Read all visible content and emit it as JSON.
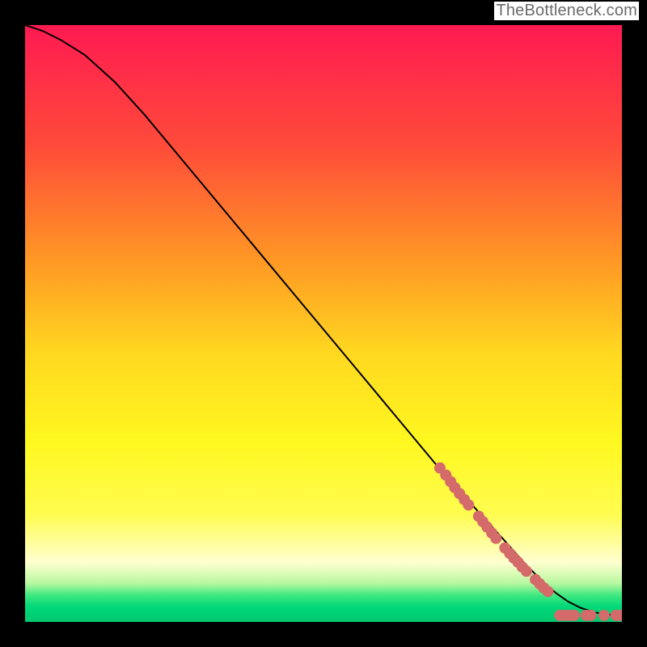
{
  "attribution": "TheBottleneck.com",
  "chart_data": {
    "type": "line",
    "title": "",
    "xlabel": "",
    "ylabel": "",
    "xlim": [
      0,
      100
    ],
    "ylim": [
      0,
      100
    ],
    "background_gradient": {
      "stops": [
        {
          "offset": 0.0,
          "color": "#ff1a52"
        },
        {
          "offset": 0.2,
          "color": "#ff4a3a"
        },
        {
          "offset": 0.4,
          "color": "#ff9a24"
        },
        {
          "offset": 0.55,
          "color": "#ffd820"
        },
        {
          "offset": 0.7,
          "color": "#fff820"
        },
        {
          "offset": 0.82,
          "color": "#fffc50"
        },
        {
          "offset": 0.9,
          "color": "#ffffd0"
        },
        {
          "offset": 0.935,
          "color": "#b8f8a0"
        },
        {
          "offset": 0.955,
          "color": "#40e880"
        },
        {
          "offset": 0.975,
          "color": "#00d878"
        },
        {
          "offset": 1.0,
          "color": "#00c870"
        }
      ]
    },
    "series": [
      {
        "name": "curve",
        "stroke": "#000000",
        "x": [
          0,
          3,
          6,
          10,
          15,
          20,
          25,
          30,
          35,
          40,
          45,
          50,
          55,
          60,
          65,
          70,
          75,
          80,
          84,
          87,
          89,
          91,
          93,
          95,
          97,
          99,
          100
        ],
        "y": [
          100,
          99,
          97.5,
          95,
          90.5,
          85,
          79,
          73,
          67,
          61,
          55,
          49,
          43,
          37,
          31,
          25,
          19.5,
          14,
          9.5,
          6.5,
          4.8,
          3.4,
          2.4,
          1.7,
          1.3,
          1.1,
          1.05
        ]
      }
    ],
    "scatter": [
      {
        "name": "points",
        "color": "#d46a6a",
        "radius": 7,
        "points": [
          {
            "x": 69.5,
            "y": 25.8
          },
          {
            "x": 70.5,
            "y": 24.6
          },
          {
            "x": 71.3,
            "y": 23.5
          },
          {
            "x": 72.0,
            "y": 22.5
          },
          {
            "x": 72.8,
            "y": 21.5
          },
          {
            "x": 73.6,
            "y": 20.5
          },
          {
            "x": 74.3,
            "y": 19.6
          },
          {
            "x": 76.0,
            "y": 17.7
          },
          {
            "x": 76.7,
            "y": 16.8
          },
          {
            "x": 77.4,
            "y": 15.9
          },
          {
            "x": 78.2,
            "y": 14.9
          },
          {
            "x": 78.9,
            "y": 14.0
          },
          {
            "x": 80.4,
            "y": 12.4
          },
          {
            "x": 81.2,
            "y": 11.5
          },
          {
            "x": 81.9,
            "y": 10.7
          },
          {
            "x": 82.6,
            "y": 10.0
          },
          {
            "x": 83.3,
            "y": 9.2
          },
          {
            "x": 84.0,
            "y": 8.5
          },
          {
            "x": 85.5,
            "y": 7.1
          },
          {
            "x": 86.2,
            "y": 6.4
          },
          {
            "x": 86.9,
            "y": 5.7
          },
          {
            "x": 87.6,
            "y": 5.1
          },
          {
            "x": 89.6,
            "y": 1.1
          },
          {
            "x": 90.5,
            "y": 1.1
          },
          {
            "x": 91.3,
            "y": 1.1
          },
          {
            "x": 92.0,
            "y": 1.1
          },
          {
            "x": 94.0,
            "y": 1.1
          },
          {
            "x": 94.8,
            "y": 1.1
          },
          {
            "x": 97.0,
            "y": 1.1
          },
          {
            "x": 99.0,
            "y": 1.1
          },
          {
            "x": 99.8,
            "y": 1.1
          }
        ]
      }
    ]
  }
}
